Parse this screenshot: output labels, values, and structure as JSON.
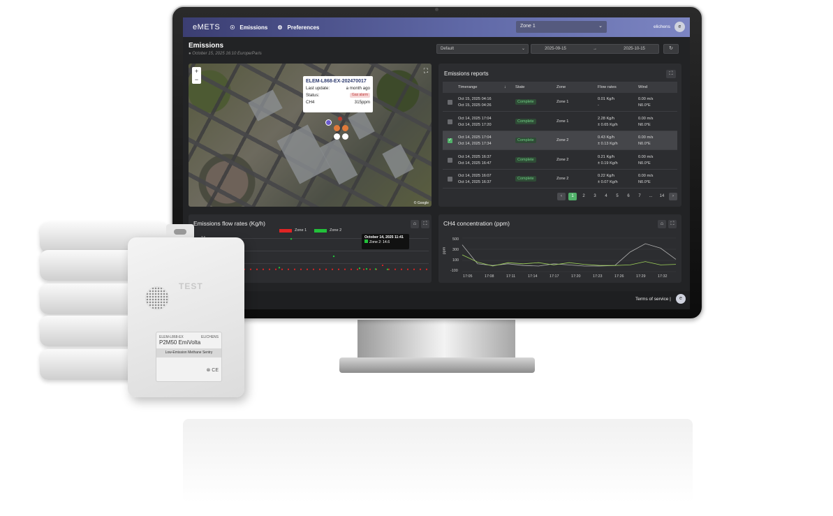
{
  "app": {
    "logo": "eMETS",
    "nav": [
      {
        "icon": "☉",
        "label": "Emissions"
      },
      {
        "icon": "⚙",
        "label": "Preferences"
      }
    ],
    "zone_select": "Zone 1",
    "user": "elichens"
  },
  "page": {
    "title": "Emissions",
    "datetime": "October 15, 2025 16:10 Europe/Paris",
    "preset": "Default",
    "date_from": "2025-09-15",
    "date_to": "2025-10-15"
  },
  "map": {
    "tooltip": {
      "title": "ELEM-L868-EX-202470017",
      "last_update_label": "Last update:",
      "last_update_value": "a month ago",
      "status_label": "Status:",
      "status_value": "Gas alarm",
      "gas_label": "CH4",
      "gas_value": "315ppm"
    },
    "credit": "© Google"
  },
  "reports": {
    "title": "Emissions reports",
    "columns": [
      "Timerange",
      "State",
      "Zone",
      "Flow rates",
      "Wind"
    ],
    "rows": [
      {
        "start": "Oct 15, 2025 04:16",
        "end": "Oct 15, 2025 04:26",
        "state": "Complete",
        "zone": "Zone 1",
        "flow": "0.01 Kg/h",
        "flow_err": "-",
        "wind": "0.00 m/s",
        "dir": "N0.0°E",
        "selected": false
      },
      {
        "start": "Oct 14, 2025 17:04",
        "end": "Oct 14, 2025 17:20",
        "state": "Complete",
        "zone": "Zone 1",
        "flow": "2.28 Kg/h",
        "flow_err": "± 0.65 Kg/h",
        "wind": "0.00 m/s",
        "dir": "N0.0°E",
        "selected": false
      },
      {
        "start": "Oct 14, 2025 17:04",
        "end": "Oct 14, 2025 17:34",
        "state": "Complete",
        "zone": "Zone 2",
        "flow": "0.43 Kg/h",
        "flow_err": "± 0.13 Kg/h",
        "wind": "0.00 m/s",
        "dir": "N0.0°E",
        "selected": true
      },
      {
        "start": "Oct 14, 2025 16:37",
        "end": "Oct 14, 2025 16:47",
        "state": "Complete",
        "zone": "Zone 2",
        "flow": "0.21 Kg/h",
        "flow_err": "± 0.19 Kg/h",
        "wind": "0.00 m/s",
        "dir": "N0.0°E",
        "selected": false
      },
      {
        "start": "Oct 14, 2025 16:07",
        "end": "Oct 14, 2025 16:37",
        "state": "Complete",
        "zone": "Zone 2",
        "flow": "0.22 Kg/h",
        "flow_err": "± 0.07 Kg/h",
        "wind": "0.00 m/s",
        "dir": "N0.0°E",
        "selected": false
      }
    ],
    "pages": [
      "1",
      "2",
      "3",
      "4",
      "5",
      "6",
      "7",
      "...",
      "14"
    ],
    "current_page": "1"
  },
  "flow_chart": {
    "title": "Emissions flow rates (Kg/h)",
    "legend": [
      {
        "name": "Zone 1",
        "color": "#e02424"
      },
      {
        "name": "Zone 2",
        "color": "#22c03a"
      }
    ],
    "y_tick": "14",
    "tooltip_title": "October 14, 2025 11:41",
    "tooltip_value": "Zone 2: 14.6"
  },
  "ch4_chart": {
    "title": "CH4 concentration (ppm)",
    "ylabel": "ppm",
    "y_ticks": [
      "500",
      "300",
      "100",
      "-100"
    ],
    "x_ticks": [
      "17:05",
      "17:08",
      "17:11",
      "17:14",
      "17:17",
      "17:20",
      "17:23",
      "17:26",
      "17:29",
      "17:32"
    ]
  },
  "footer": {
    "terms": "Terms of service",
    "separator": "|"
  },
  "device": {
    "test_label": "TEST",
    "model": "ELEM-L868-EX",
    "brand_small": "ELICHENS",
    "product": "P2M50 EmiVolta",
    "tagline": "Low-Emission Methane Sentry"
  },
  "chart_data": [
    {
      "type": "scatter",
      "title": "Emissions flow rates (Kg/h)",
      "ylabel": "",
      "series": [
        {
          "name": "Zone 1",
          "values": [
            0.4,
            0.4,
            0.4,
            0.4,
            0.4,
            0.4,
            0.4,
            0.4,
            0.4,
            0.4,
            0.4,
            0.4,
            0.4,
            0.4,
            0.4,
            0.4,
            0.4,
            0.4,
            0.4,
            0.4,
            0.4,
            0.4,
            2.3,
            0.4,
            0.4,
            0.4,
            0.4,
            0.4,
            0.4,
            0.4
          ]
        },
        {
          "name": "Zone 2",
          "values": [
            1.2,
            14.6,
            6.5,
            0.9,
            0.6,
            0.5,
            0.4
          ]
        }
      ]
    },
    {
      "type": "line",
      "title": "CH4 concentration (ppm)",
      "ylabel": "ppm",
      "x": [
        "17:05",
        "17:08",
        "17:11",
        "17:14",
        "17:17",
        "17:20",
        "17:23",
        "17:26",
        "17:29",
        "17:32"
      ],
      "ylim": [
        -100,
        550
      ],
      "series": [
        {
          "name": "",
          "color": "#b0b0b0",
          "values": [
            380,
            40,
            10,
            40,
            10,
            0,
            40,
            20,
            0,
            0,
            10,
            250,
            400,
            320,
            120
          ]
        },
        {
          "name": "",
          "color": "#9fd35a",
          "values": [
            200,
            70,
            0,
            60,
            40,
            60,
            20,
            60,
            30,
            10,
            10,
            20,
            80,
            20,
            30
          ]
        }
      ]
    }
  ]
}
